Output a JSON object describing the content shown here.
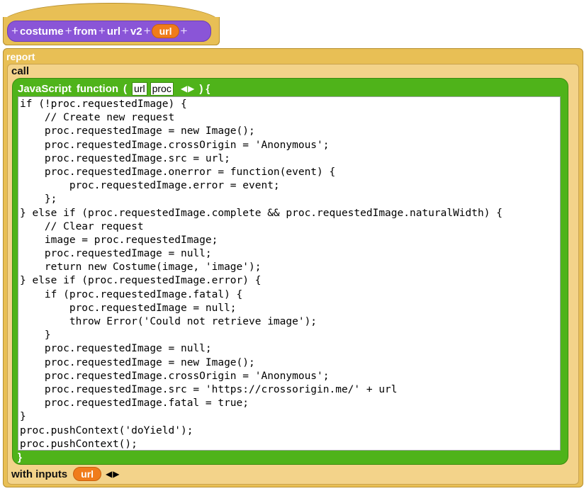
{
  "hat": {
    "tokens": [
      "costume",
      "from",
      "url",
      "v2"
    ],
    "input_slot": "url"
  },
  "report": {
    "label": "report"
  },
  "call": {
    "label": "call"
  },
  "js_function": {
    "keyword_1": "JavaScript",
    "keyword_2": "function",
    "open_paren": "(",
    "params": [
      "url",
      "proc"
    ],
    "close": ") {",
    "end_brace": "}",
    "code_lines": [
      "if (!proc.requestedImage) {",
      "    // Create new request",
      "    proc.requestedImage = new Image();",
      "    proc.requestedImage.crossOrigin = 'Anonymous';",
      "    proc.requestedImage.src = url;",
      "    proc.requestedImage.onerror = function(event) {",
      "        proc.requestedImage.error = event;",
      "    };",
      "} else if (proc.requestedImage.complete && proc.requestedImage.naturalWidth) {",
      "    // Clear request",
      "    image = proc.requestedImage;",
      "    proc.requestedImage = null;",
      "    return new Costume(image, 'image');",
      "} else if (proc.requestedImage.error) {",
      "    if (proc.requestedImage.fatal) {",
      "        proc.requestedImage = null;",
      "        throw Error('Could not retrieve image');",
      "    }",
      "    proc.requestedImage = null;",
      "    proc.requestedImage = new Image();",
      "    proc.requestedImage.crossOrigin = 'Anonymous';",
      "    proc.requestedImage.src = 'https://crossorigin.me/' + url",
      "    proc.requestedImage.fatal = true;",
      "}",
      "proc.pushContext('doYield');",
      "proc.pushContext();"
    ]
  },
  "with_inputs": {
    "label": "with inputs",
    "input": "url"
  },
  "colors": {
    "control": "#e8bf55",
    "custom_block": "#8a55d7",
    "variable": "#f07c1b",
    "operators": "#4fb31a"
  }
}
